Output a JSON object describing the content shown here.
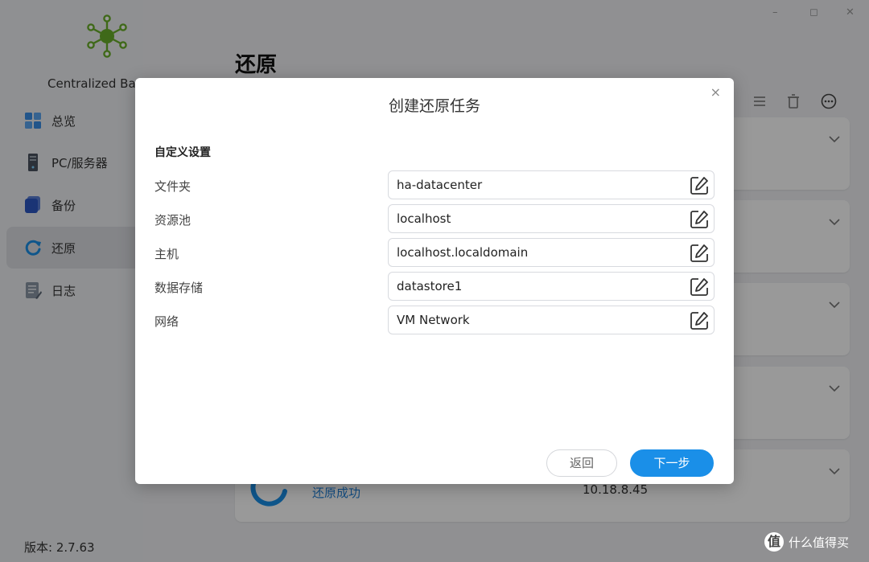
{
  "sidebar": {
    "app_name": "Centralized Ba",
    "items": [
      {
        "label": "总览",
        "icon": "overview-grid-icon"
      },
      {
        "label": "PC/服务器",
        "icon": "server-tower-icon"
      },
      {
        "label": "备份",
        "icon": "backup-stack-icon"
      },
      {
        "label": "还原",
        "icon": "restore-cycle-icon",
        "active": true
      },
      {
        "label": "日志",
        "icon": "log-document-icon"
      }
    ],
    "version": "版本: 2.7.63"
  },
  "window": {
    "controls": [
      "–",
      "◻",
      "✕"
    ]
  },
  "main": {
    "title": "还原",
    "toolbar_icons": [
      "list-icon",
      "trash-icon",
      "more-icon"
    ],
    "cards": [
      {
        "status": "",
        "ip": ""
      },
      {
        "status": "",
        "ip": ""
      },
      {
        "status": "",
        "ip": ""
      },
      {
        "status": "",
        "ip": ""
      },
      {
        "status": "还原成功",
        "ip": "10.18.8.45"
      }
    ]
  },
  "dialog": {
    "title": "创建还原任务",
    "close": "×",
    "section_title": "自定义设置",
    "fields": [
      {
        "label": "文件夹",
        "value": "ha-datacenter"
      },
      {
        "label": "资源池",
        "value": "localhost"
      },
      {
        "label": "主机",
        "value": "localhost.localdomain"
      },
      {
        "label": "数据存储",
        "value": "datastore1"
      },
      {
        "label": "网络",
        "value": "VM Network"
      }
    ],
    "back_label": "返回",
    "next_label": "下一步"
  },
  "watermark": {
    "badge": "值",
    "text": "什么值得买"
  },
  "colors": {
    "accent": "#1a8fe8",
    "logo_green": "#6aaf2a",
    "status_blue": "#1f7fd6"
  }
}
